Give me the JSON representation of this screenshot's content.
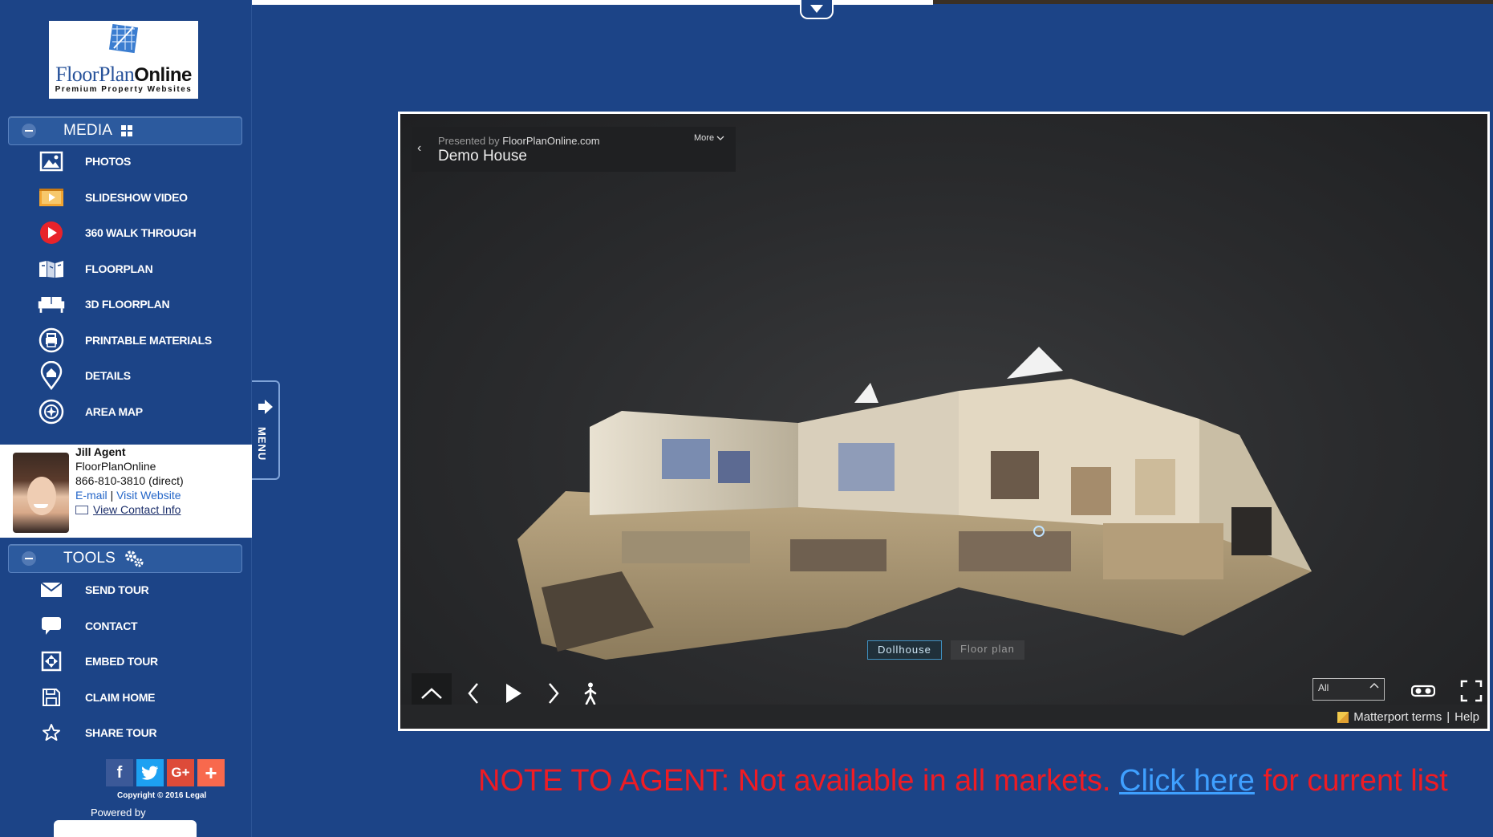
{
  "logo": {
    "brand_light": "FloorPlan",
    "brand_bold": "Online",
    "tagline": "Premium Property Websites"
  },
  "media_section": {
    "title": "MEDIA",
    "icon": "grid-icon"
  },
  "media_items": [
    {
      "label": "PHOTOS",
      "icon": "photo-icon"
    },
    {
      "label": "SLIDESHOW VIDEO",
      "icon": "slideshow-icon"
    },
    {
      "label": "360 WALK THROUGH",
      "icon": "play-circle-icon"
    },
    {
      "label": "FLOORPLAN",
      "icon": "map-icon"
    },
    {
      "label": "3D FLOORPLAN",
      "icon": "sofa-icon"
    },
    {
      "label": "PRINTABLE MATERIALS",
      "icon": "printer-icon"
    },
    {
      "label": "DETAILS",
      "icon": "location-pin-icon"
    },
    {
      "label": "AREA MAP",
      "icon": "compass-icon"
    }
  ],
  "agent": {
    "name": "Jill Agent",
    "company": "FloorPlanOnline",
    "phone": "866-810-3810 (direct)",
    "email_label": "E-mail",
    "separator": "|",
    "website_label": "Visit Website",
    "contact_label": "View Contact Info"
  },
  "menu_tab": {
    "label": "MENU"
  },
  "tools_section": {
    "title": "TOOLS",
    "icon": "gears-icon"
  },
  "tools_items": [
    {
      "label": "SEND TOUR",
      "icon": "envelope-icon"
    },
    {
      "label": "CONTACT",
      "icon": "speech-bubble-icon"
    },
    {
      "label": "EMBED TOUR",
      "icon": "embed-icon"
    },
    {
      "label": "CLAIM HOME",
      "icon": "save-icon"
    },
    {
      "label": "SHARE TOUR",
      "icon": "star-icon"
    }
  ],
  "social": [
    {
      "label": "f",
      "icon": "facebook-icon",
      "color": "#3b5998"
    },
    {
      "label": "t",
      "icon": "twitter-icon",
      "color": "#1da1f2"
    },
    {
      "label": "G+",
      "icon": "google-plus-icon",
      "color": "#dd4b39"
    },
    {
      "label": "+",
      "icon": "addthis-icon",
      "color": "#f8694d"
    }
  ],
  "footer": {
    "copyright": "Copyright © 2016 Legal",
    "powered": "Powered by"
  },
  "viewer": {
    "presented_prefix": "Presented by",
    "presenter": "FloorPlanOnline.com",
    "house_name": "Demo House",
    "more_label": "More",
    "mode_dollhouse": "Dollhouse",
    "mode_floorplan": "Floor plan",
    "floor_select_value": "All",
    "terms_label": "Matterport terms",
    "terms_sep": "|",
    "help_label": "Help"
  },
  "note": {
    "prefix": "NOTE TO AGENT: Not available in all markets.",
    "link": "Click here",
    "suffix": "for current list"
  },
  "colors": {
    "background": "#1c4487",
    "note_red": "#ee1c24",
    "link_blue": "#3fa0ff"
  }
}
